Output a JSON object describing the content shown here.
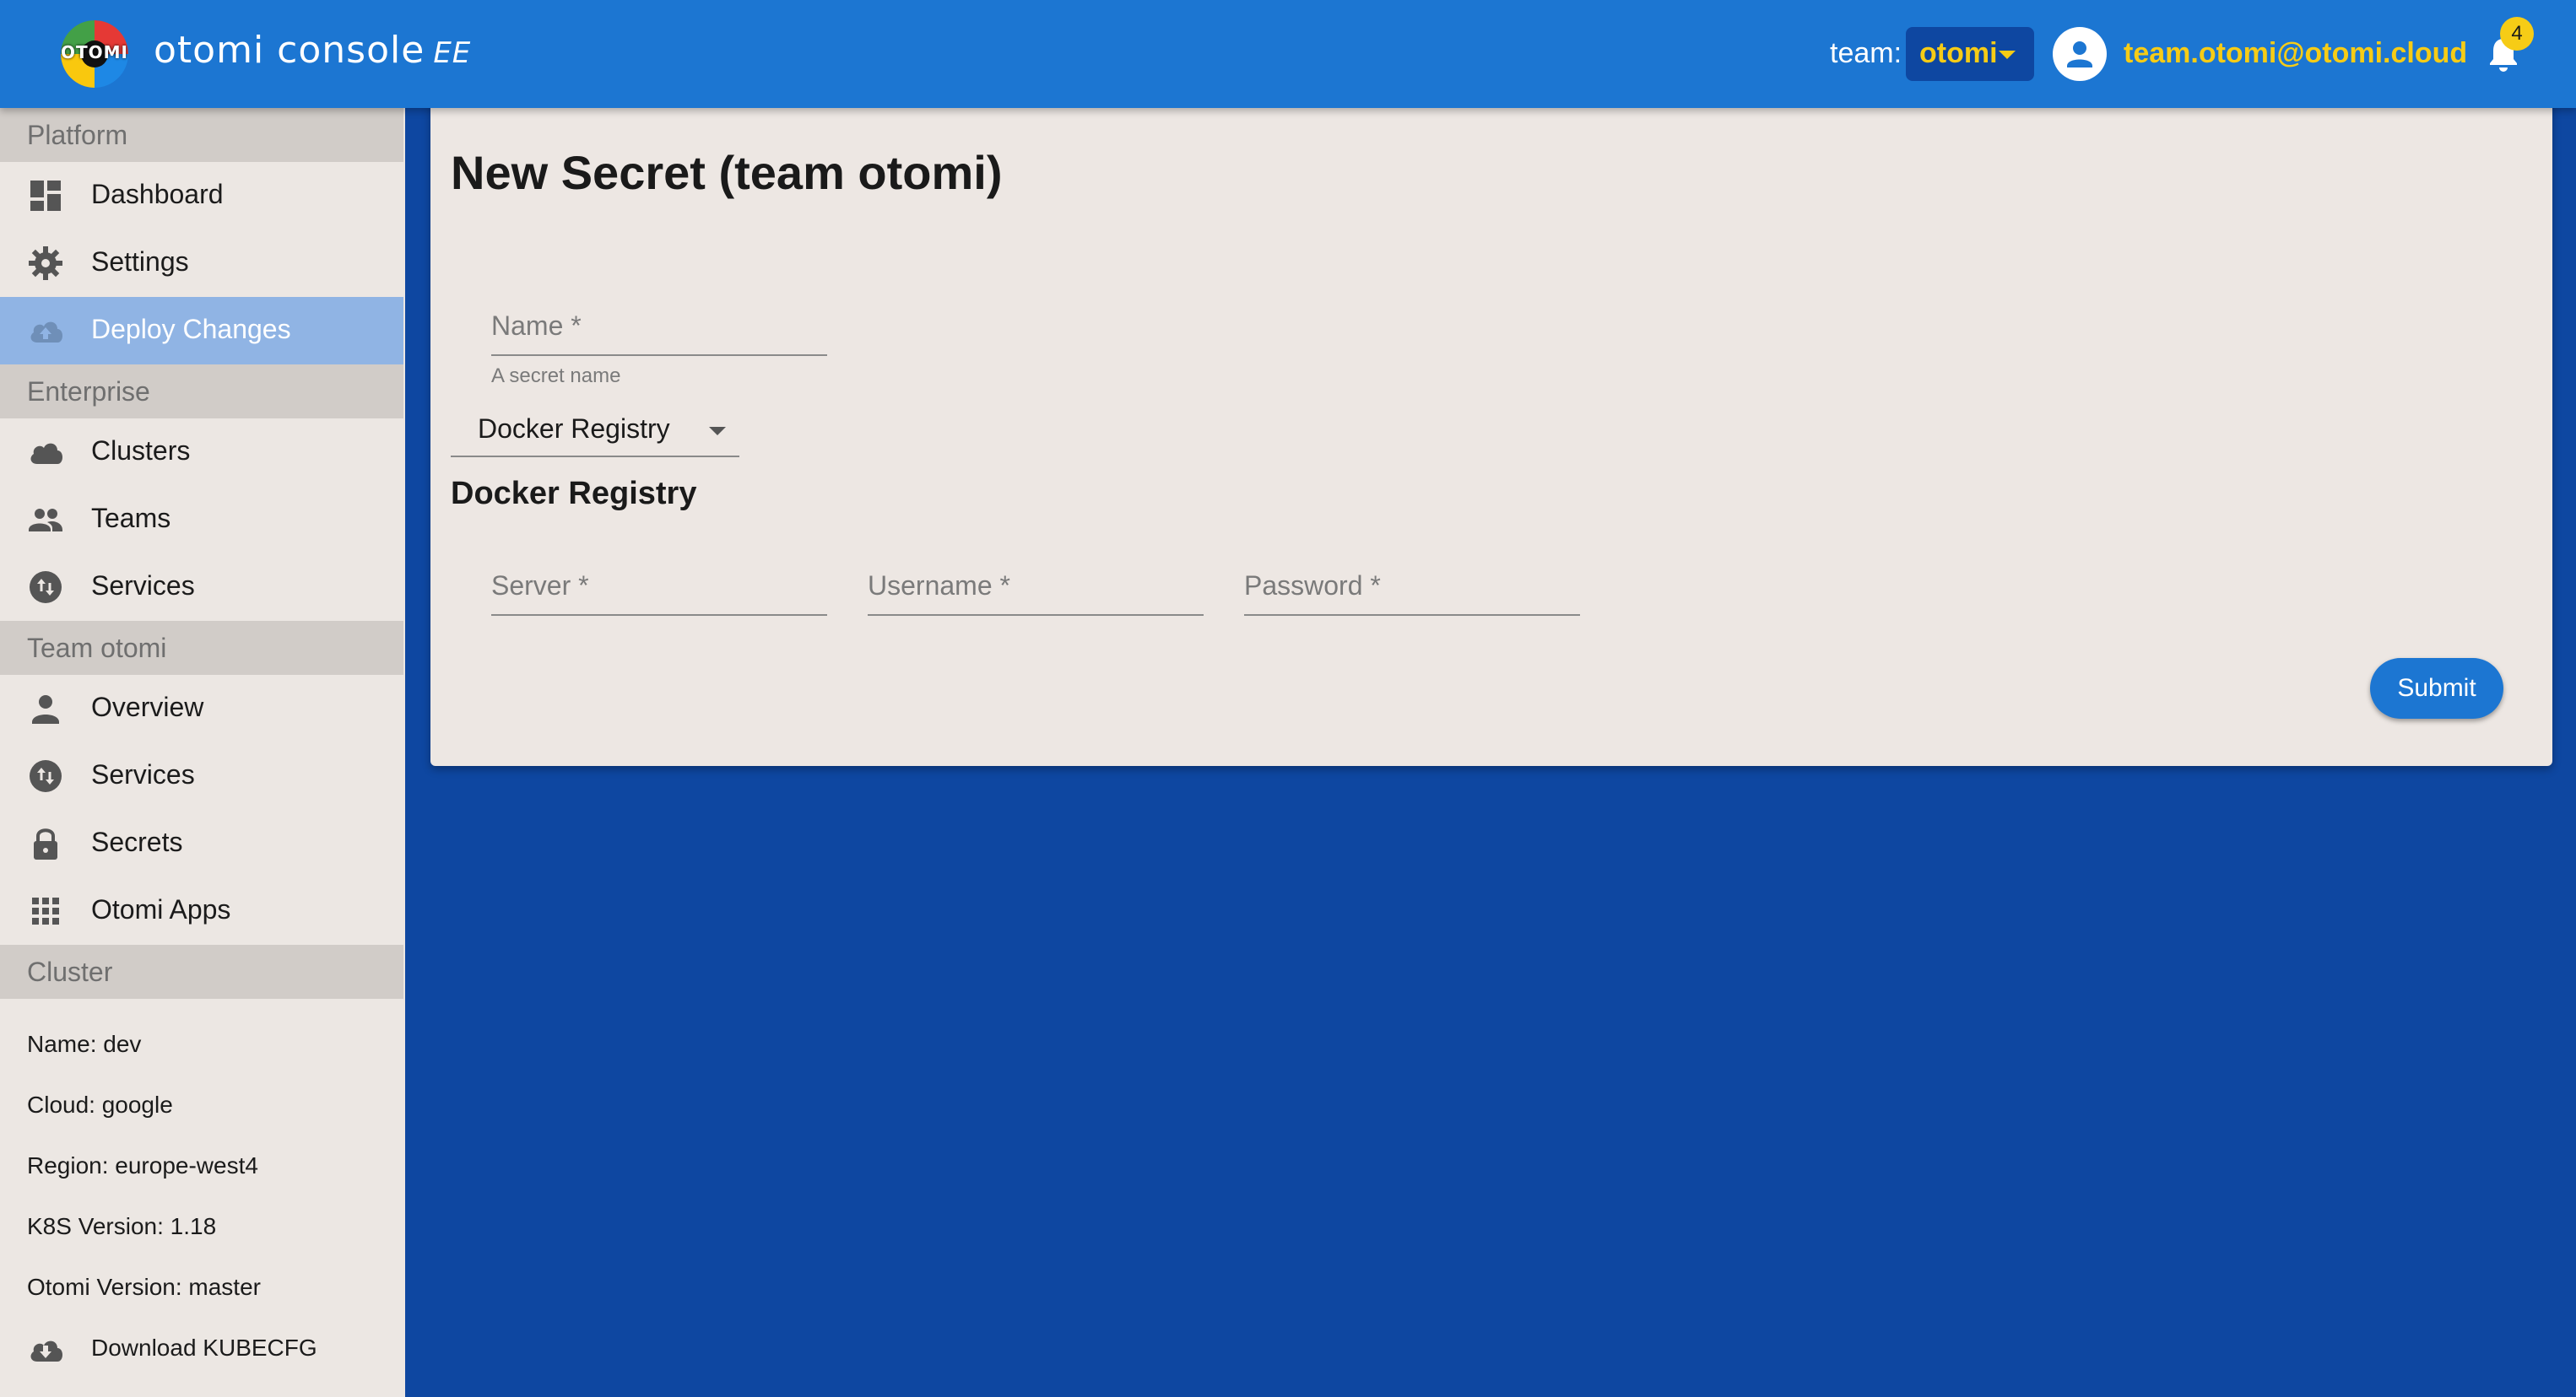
{
  "header": {
    "app_title": "otomi console",
    "edition": "EE",
    "logo_text": "OTOMI",
    "team_label": "team:",
    "team_value": "otomi",
    "user_email": "team.otomi@otomi.cloud",
    "notification_count": "4"
  },
  "sidebar": {
    "sections": {
      "platform": "Platform",
      "enterprise": "Enterprise",
      "team": "Team otomi",
      "cluster": "Cluster"
    },
    "platform_items": [
      {
        "label": "Dashboard",
        "icon": "dashboard-icon"
      },
      {
        "label": "Settings",
        "icon": "gear-icon"
      },
      {
        "label": "Deploy Changes",
        "icon": "cloud-upload-icon",
        "active": true
      }
    ],
    "enterprise_items": [
      {
        "label": "Clusters",
        "icon": "cloud-icon"
      },
      {
        "label": "Teams",
        "icon": "people-icon"
      },
      {
        "label": "Services",
        "icon": "swap-icon"
      }
    ],
    "team_items": [
      {
        "label": "Overview",
        "icon": "person-icon"
      },
      {
        "label": "Services",
        "icon": "swap-icon"
      },
      {
        "label": "Secrets",
        "icon": "lock-icon"
      },
      {
        "label": "Otomi Apps",
        "icon": "apps-grid-icon"
      }
    ],
    "cluster_info": [
      "Name: dev",
      "Cloud: google",
      "Region: europe-west4",
      "K8S Version: 1.18",
      "Otomi Version: master"
    ],
    "download": {
      "label": "Download KUBECFG",
      "icon": "cloud-download-icon"
    }
  },
  "form": {
    "title": "New Secret (team otomi)",
    "name_placeholder": "Name *",
    "name_helper": "A secret name",
    "type_value": "Docker Registry",
    "section_title": "Docker Registry",
    "server_placeholder": "Server *",
    "username_placeholder": "Username *",
    "password_placeholder": "Password *",
    "submit_label": "Submit"
  },
  "colors": {
    "header": "#1c76d2",
    "background": "#0e47a1",
    "accent": "#f6cc16",
    "sidebar": "#ece7e3",
    "active_item": "#90b4e4"
  }
}
